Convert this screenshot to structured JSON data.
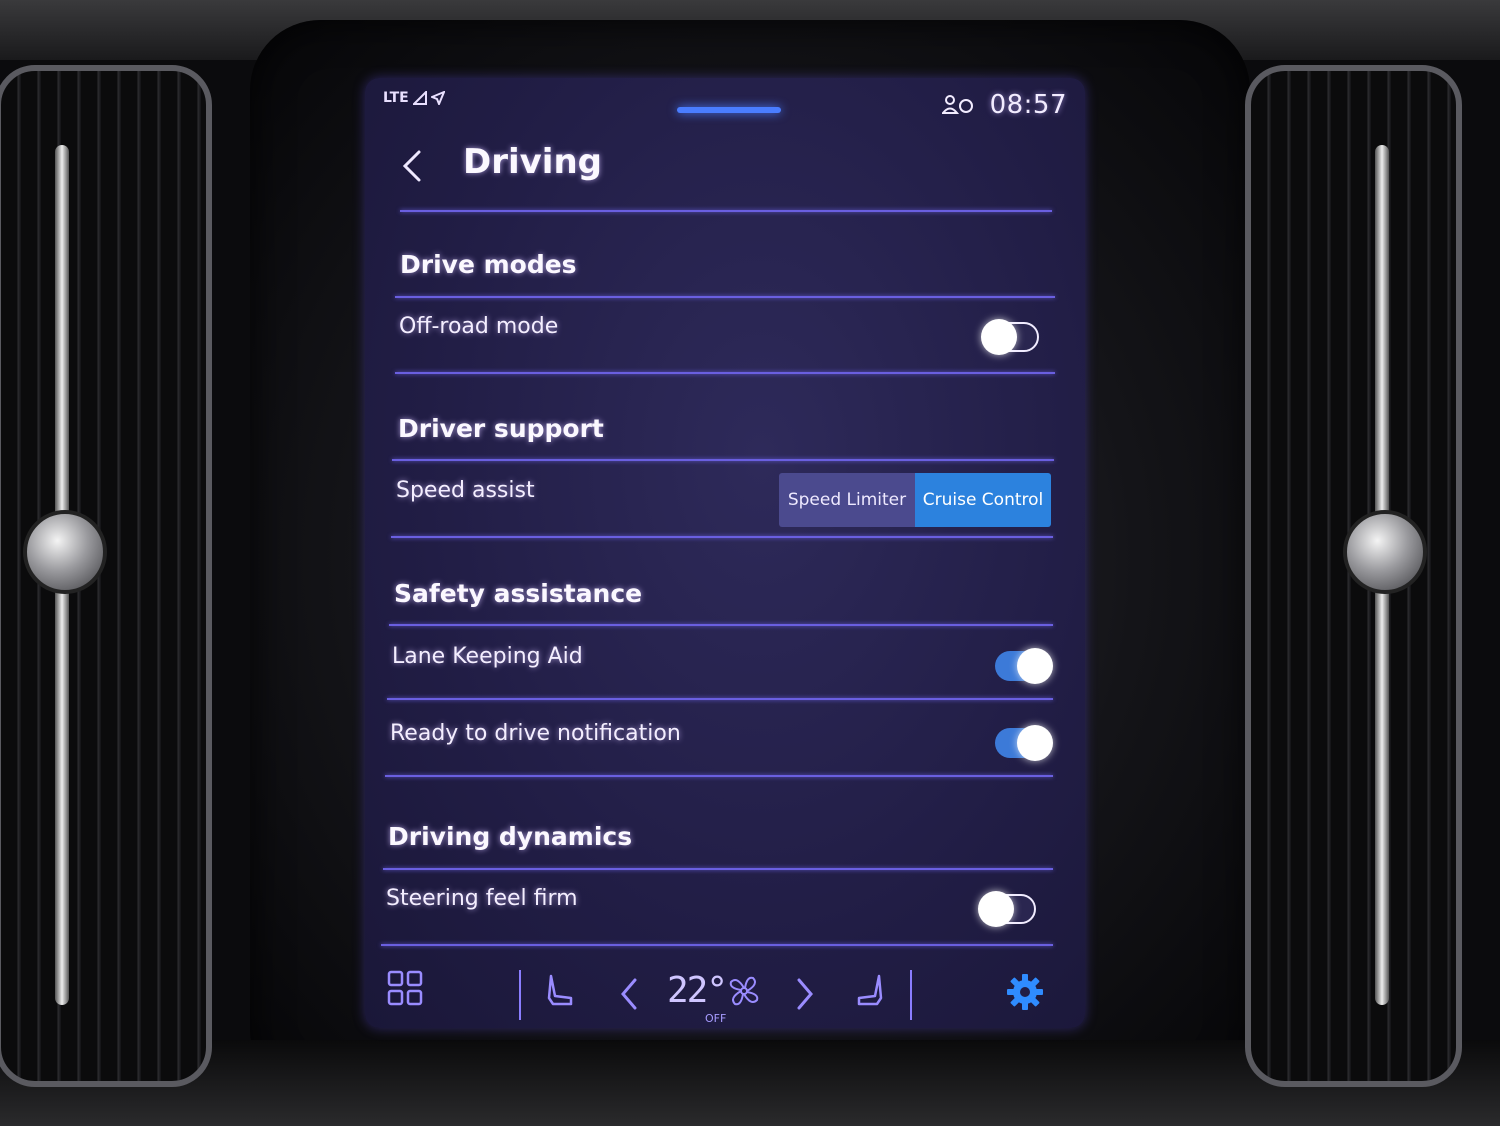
{
  "status": {
    "network": "LTE",
    "time": "08:57"
  },
  "header": {
    "title": "Driving"
  },
  "sections": {
    "drive_modes": {
      "title": "Drive modes",
      "off_road": {
        "label": "Off-road mode",
        "enabled": false
      }
    },
    "driver_support": {
      "title": "Driver support",
      "speed_assist": {
        "label": "Speed assist",
        "options": [
          "Speed Limiter",
          "Cruise Control"
        ],
        "selected": "Cruise Control"
      }
    },
    "safety_assistance": {
      "title": "Safety assistance",
      "lane_keeping": {
        "label": "Lane Keeping Aid",
        "enabled": true
      },
      "ready_notification": {
        "label": "Ready to drive notification",
        "enabled": true
      }
    },
    "driving_dynamics": {
      "title": "Driving dynamics",
      "steering_firm": {
        "label": "Steering feel firm",
        "enabled": false
      }
    }
  },
  "climate": {
    "temperature": "22°",
    "fan_status": "OFF"
  },
  "colors": {
    "accent": "#2c82de",
    "background": "#211d45",
    "divider": "#6a5fe0"
  },
  "icons": [
    "signal-icon",
    "navigation-arrow-icon",
    "profile-icon",
    "back-icon",
    "apps-grid-icon",
    "seat-heat-left-icon",
    "chevron-left-icon",
    "fan-icon",
    "chevron-right-icon",
    "seat-heat-right-icon",
    "settings-gear-icon"
  ]
}
